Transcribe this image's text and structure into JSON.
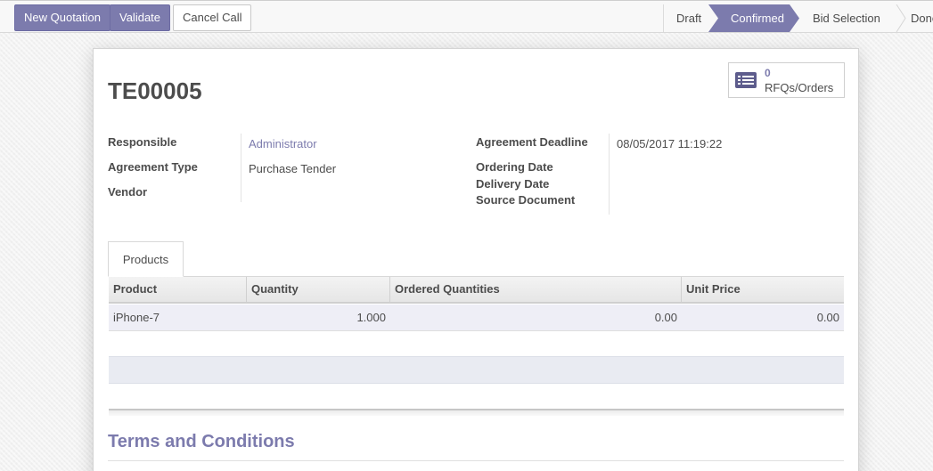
{
  "toolbar": {
    "new_quotation": "New Quotation",
    "validate": "Validate",
    "cancel_call": "Cancel Call"
  },
  "statusbar": {
    "stages": [
      "Draft",
      "Confirmed",
      "Bid Selection",
      "Done"
    ],
    "active_stage": "Confirmed"
  },
  "smart_button": {
    "count": "0",
    "label": "RFQs/Orders",
    "icon": "list-icon"
  },
  "record": {
    "title": "TE00005",
    "responsible_label": "Responsible",
    "responsible_value": "Administrator",
    "agreement_type_label": "Agreement Type",
    "agreement_type_value": "Purchase Tender",
    "vendor_label": "Vendor",
    "vendor_value": "",
    "deadline_label": "Agreement Deadline",
    "deadline_value": "08/05/2017 11:19:22",
    "ordering_date_label": "Ordering Date",
    "ordering_date_value": "",
    "delivery_date_label": "Delivery Date",
    "delivery_date_value": "",
    "source_document_label": "Source Document",
    "source_document_value": ""
  },
  "tabs": [
    {
      "label": "Products"
    }
  ],
  "table": {
    "columns": [
      "Product",
      "Quantity",
      "Ordered Quantities",
      "Unit Price"
    ],
    "rows": [
      {
        "product": "iPhone-7",
        "quantity": "1.000",
        "ordered_quantities": "0.00",
        "unit_price": "0.00"
      }
    ]
  },
  "terms": {
    "heading": "Terms and Conditions"
  },
  "colors": {
    "accent": "#7c7bad",
    "row_highlight": "#eeeef6"
  }
}
